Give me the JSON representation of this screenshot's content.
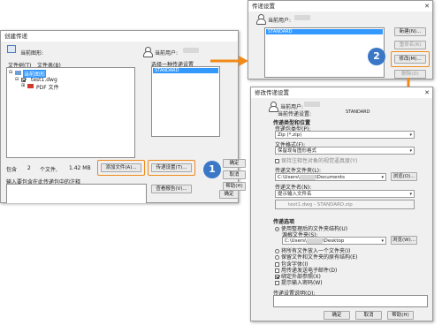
{
  "colors": {
    "accent_orange": "#f08a1a",
    "badge_blue": "#3a78c7",
    "selection_blue": "#3399ff"
  },
  "main_dialog": {
    "title": "创建传递",
    "current_drawing_label": "当前图形:",
    "tabs": [
      "文件树(T)",
      "文件表(B)"
    ],
    "tree": {
      "root": "当前图形",
      "child": "test1.dwg",
      "grandchild": "PDF 文件"
    },
    "current_user_label": "当前用户:",
    "select_setup_label": "选择一种传递设置",
    "setup_list": [
      "STANDARD"
    ],
    "summary": {
      "label": "包含",
      "count": "2",
      "files_label": "个文件,",
      "size": "1.42 MB"
    },
    "add_file_button": "添加文件(A)...",
    "transmittal_setup_button": "传递设置(T)...",
    "notes_label": "输入要包含在此传递包中的注释",
    "view_report_button": "查看报告(V)...",
    "ok_button": "确定",
    "cancel_button": "取消",
    "help_button": "帮助(H)"
  },
  "setups_dialog": {
    "title": "传递设置",
    "current_user_label": "当前用户:",
    "list_items": [
      "STANDARD"
    ],
    "new_button": "新建(N)...",
    "rename_button": "重命名(R)",
    "modify_button": "修改(M)...",
    "delete_button": "删除(D)"
  },
  "modify_dialog": {
    "title": "修改传递设置",
    "current_user_label": "当前用户:",
    "current_setup_label": "当前传递设置:",
    "current_setup_value": "STANDARD",
    "package_location_group": "传递类型和位置",
    "package_type_label": "传递包类型(P):",
    "package_type_value": "Zip (*.zip)",
    "file_format_label": "文件格式(F):",
    "file_format_value": "保留现有图形格式",
    "visual_fidelity_label": "保持注释性对象的视觉逼真度(Y)",
    "folder_label": "传递文件文件夹(L):",
    "folder_value_prefix": "C:\\Users\\",
    "folder_value_suffix": "\\Documents",
    "browse_button": "浏览(O)...",
    "file_name_label": "传递文件名(N):",
    "file_name_value": "提示输入文件名",
    "file_name_preview": "test1.dwg - STANDARD.zip",
    "options_group": "传递选项",
    "option_organized": "使用整理后的文件夹结构(U)",
    "source_root_label": "源根文件夹(S):",
    "source_root_prefix": "C:\\Users\\",
    "source_root_suffix": "\\Desktop",
    "browse_button2": "浏览(W)...",
    "option_single_folder": "将所有文件放入一个文件夹(I)",
    "option_keep_structure": "保留文件和文件夹的原有结构(E)",
    "cb_include_fonts": "包含字体(I)",
    "cb_send_email": "用传递发送电子邮件(D)",
    "cb_bind_xrefs": "绑定外部参照(X)",
    "cb_prompt_password": "提示输入密码(W)",
    "description_label": "传递设置说明(O):",
    "ok_button": "确定",
    "cancel_button": "取消",
    "help_button": "帮助(H)"
  },
  "badges": {
    "step1": "1",
    "step2": "2"
  }
}
